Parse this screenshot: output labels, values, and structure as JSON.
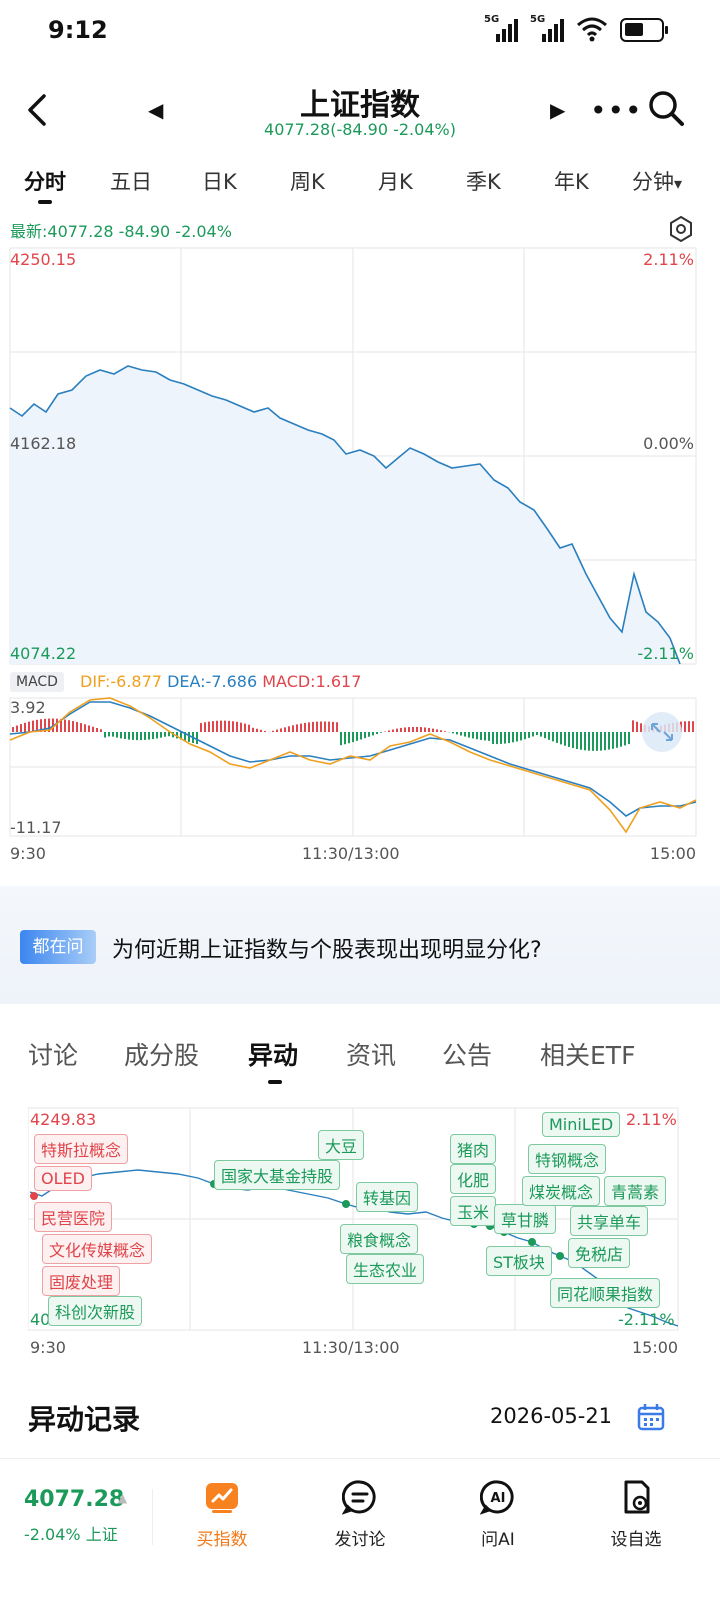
{
  "status_bar": {
    "time": "9:12",
    "sig1": "5G",
    "sig2": "5G",
    "wifi_sub": "6"
  },
  "header": {
    "title": "上证指数",
    "subtitle": "4077.28(-84.90 -2.04%)",
    "back_icon": "back-icon",
    "prev_icon": "triangle-left-icon",
    "next_icon": "triangle-right-icon",
    "more_icon": "more-icon",
    "search_icon": "search-icon"
  },
  "period_tabs": [
    "分时",
    "五日",
    "日K",
    "周K",
    "月K",
    "季K",
    "年K",
    "分钟"
  ],
  "period_tab_dropdown": "▾",
  "chart": {
    "latest": "最新:4077.28  -84.90  -2.04%",
    "top_left": "4250.15",
    "top_right": "2.11%",
    "mid_left": "4162.18",
    "mid_right": "0.00%",
    "bot_left": "4074.22",
    "bot_right": "-2.11%",
    "macd_tag": "MACD",
    "dif": "DIF:-6.877",
    "dea": "DEA:-7.686",
    "macd": "MACD:1.617",
    "macd_top": "3.92",
    "macd_bot": "-11.17",
    "x_start": "9:30",
    "x_mid": "11:30/13:00",
    "x_end": "15:00",
    "colors": {
      "line": "#2a7fbf",
      "up": "#e0454b",
      "down": "#1c9a5a",
      "dea": "#2a7fbf",
      "dif": "#f0a020"
    }
  },
  "ask": {
    "badge": "都在问",
    "text": "为何近期上证指数与个股表现出现明显分化?"
  },
  "section_tabs": [
    "讨论",
    "成分股",
    "异动",
    "资讯",
    "公告",
    "相关ETF"
  ],
  "anomaly": {
    "top_left": "4249.83",
    "top_right": "2.11%",
    "bot_left": "4074.53",
    "bot_right": "-2.11%",
    "x_start": "9:30",
    "x_mid": "11:30/13:00",
    "x_end": "15:00",
    "chips": [
      {
        "t": "特斯拉概念",
        "c": "r"
      },
      {
        "t": "OLED",
        "c": "r"
      },
      {
        "t": "民营医院",
        "c": "r"
      },
      {
        "t": "文化传媒概念",
        "c": "r"
      },
      {
        "t": "固废处理",
        "c": "r"
      },
      {
        "t": "科创次新股",
        "c": "g"
      },
      {
        "t": "国家大基金持股",
        "c": "g"
      },
      {
        "t": "大豆",
        "c": "g"
      },
      {
        "t": "转基因",
        "c": "g"
      },
      {
        "t": "粮食概念",
        "c": "g"
      },
      {
        "t": "生态农业",
        "c": "g"
      },
      {
        "t": "猪肉",
        "c": "g"
      },
      {
        "t": "化肥",
        "c": "g"
      },
      {
        "t": "玉米",
        "c": "g"
      },
      {
        "t": "草甘膦",
        "c": "g"
      },
      {
        "t": "ST板块",
        "c": "g"
      },
      {
        "t": "MiniLED",
        "c": "g"
      },
      {
        "t": "特钢概念",
        "c": "g"
      },
      {
        "t": "煤炭概念",
        "c": "g"
      },
      {
        "t": "青蒿素",
        "c": "g"
      },
      {
        "t": "共享单车",
        "c": "g"
      },
      {
        "t": "免税店",
        "c": "g"
      },
      {
        "t": "同花顺果指数",
        "c": "g"
      }
    ]
  },
  "record": {
    "title": "异动记录",
    "date": "2026-05-21",
    "icon": "calendar-icon"
  },
  "bottom": {
    "price": "4077.28",
    "price_arrow": "▲",
    "change": "-2.04% 上证",
    "buttons": [
      {
        "label": "买指数",
        "icon": "buy-index-icon"
      },
      {
        "label": "发讨论",
        "icon": "discuss-icon"
      },
      {
        "label": "问AI",
        "icon": "ai-icon"
      },
      {
        "label": "设自选",
        "icon": "watchlist-icon"
      }
    ]
  }
}
